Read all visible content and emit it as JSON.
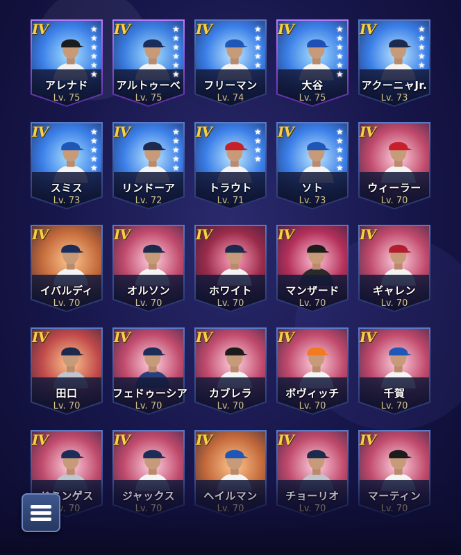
{
  "cards": [
    {
      "grade": "IV",
      "name": "アレナド",
      "level": "Lv. 75",
      "photo_bg": "#3b7fe8",
      "photo_fx": "#a7e0ff",
      "cap": "#1c1c1c",
      "jersey": "#f2f2f2",
      "stars": 6,
      "frame": "purple"
    },
    {
      "grade": "IV",
      "name": "アルトゥーベ",
      "level": "Lv. 75",
      "photo_bg": "#3a7ce0",
      "photo_fx": "#a7e0ff",
      "cap": "#1d2d5a",
      "jersey": "#f2f2f2",
      "stars": 6,
      "frame": "purple"
    },
    {
      "grade": "IV",
      "name": "フリーマン",
      "level": "Lv. 74",
      "photo_bg": "#3b7fe8",
      "photo_fx": "#bfe8ff",
      "cap": "#1e57b7",
      "jersey": "#f4f4f4",
      "stars": 5,
      "frame": "blue"
    },
    {
      "grade": "IV",
      "name": "大谷",
      "level": "Lv. 75",
      "photo_bg": "#3c7fe6",
      "photo_fx": "#a7e0ff",
      "cap": "#1f4fb5",
      "jersey": "#f4f4f4",
      "stars": 6,
      "frame": "purple"
    },
    {
      "grade": "IV",
      "name": "アクーニャJr.",
      "level": "Lv. 73",
      "photo_bg": "#3b7fe8",
      "photo_fx": "#bfe8ff",
      "cap": "#1c2a4d",
      "jersey": "#f4f4f4",
      "stars": 5,
      "frame": "blue"
    },
    {
      "grade": "IV",
      "name": "スミス",
      "level": "Lv. 73",
      "photo_bg": "#3b7fe8",
      "photo_fx": "#a7e0ff",
      "cap": "#1e57b7",
      "jersey": "#f4f4f4",
      "stars": 5,
      "frame": "blue"
    },
    {
      "grade": "IV",
      "name": "リンドーア",
      "level": "Lv. 72",
      "photo_bg": "#3b7fe8",
      "photo_fx": "#bfe8ff",
      "cap": "#1c2a4d",
      "jersey": "#f4f4f4",
      "stars": 5,
      "frame": "blue"
    },
    {
      "grade": "IV",
      "name": "トラウト",
      "level": "Lv. 71",
      "photo_bg": "#3b7fe8",
      "photo_fx": "#bfe8ff",
      "cap": "#c8202b",
      "jersey": "#f4f4f4",
      "stars": 4,
      "frame": "blue"
    },
    {
      "grade": "IV",
      "name": "ソト",
      "level": "Lv. 73",
      "photo_bg": "#3b7fe8",
      "photo_fx": "#bfe8ff",
      "cap": "#1e57b7",
      "jersey": "#f4f4f4",
      "stars": 5,
      "frame": "blue"
    },
    {
      "grade": "IV",
      "name": "ウィーラー",
      "level": "Lv. 70",
      "photo_bg": "#c04a6c",
      "photo_fx": "#ffd1e0",
      "cap": "#c8202b",
      "jersey": "#f4f4f4",
      "stars": 0,
      "frame": "blue"
    },
    {
      "grade": "IV",
      "name": "イバルディ",
      "level": "Lv. 70",
      "photo_bg": "#c46a3b",
      "photo_fx": "#ffc68e",
      "cap": "#1d2d5a",
      "jersey": "#f4f4f4",
      "stars": 0,
      "frame": "blue"
    },
    {
      "grade": "IV",
      "name": "オルソン",
      "level": "Lv. 70",
      "photo_bg": "#c04a6c",
      "photo_fx": "#ffd1e0",
      "cap": "#1c2a4d",
      "jersey": "#f4f4f4",
      "stars": 0,
      "frame": "blue"
    },
    {
      "grade": "IV",
      "name": "ホワイト",
      "level": "Lv. 70",
      "photo_bg": "#9a2b4a",
      "photo_fx": "#ff9fbd",
      "cap": "#1c2a4d",
      "jersey": "#f4f4f4",
      "stars": 0,
      "frame": "blue"
    },
    {
      "grade": "IV",
      "name": "マンザード",
      "level": "Lv. 70",
      "photo_bg": "#b3305a",
      "photo_fx": "#ffc0d6",
      "cap": "#1c1c1c",
      "jersey": "#2a2a2a",
      "stars": 0,
      "frame": "blue"
    },
    {
      "grade": "IV",
      "name": "ギャレン",
      "level": "Lv. 70",
      "photo_bg": "#c04a6c",
      "photo_fx": "#ffd1e0",
      "cap": "#b11e2e",
      "jersey": "#f4f4f4",
      "stars": 0,
      "frame": "blue"
    },
    {
      "grade": "IV",
      "name": "田口",
      "level": "Lv. 70",
      "photo_bg": "#c04a4a",
      "photo_fx": "#ffc68e",
      "cap": "#1c2a4d",
      "jersey": "#c0c4cc",
      "stars": 0,
      "frame": "blue"
    },
    {
      "grade": "IV",
      "name": "フェドゥーシア",
      "level": "Lv. 70",
      "photo_bg": "#c04a6c",
      "photo_fx": "#ffd1e0",
      "cap": "#1d2d5a",
      "jersey": "#2a3f7a",
      "stars": 0,
      "frame": "blue"
    },
    {
      "grade": "IV",
      "name": "カブレラ",
      "level": "Lv. 70",
      "photo_bg": "#c04a6c",
      "photo_fx": "#ffd1e0",
      "cap": "#1c1c1c",
      "jersey": "#f4f4f4",
      "stars": 0,
      "frame": "blue"
    },
    {
      "grade": "IV",
      "name": "ボヴィッチ",
      "level": "Lv. 70",
      "photo_bg": "#c04a6c",
      "photo_fx": "#ffd1e0",
      "cap": "#f47a1f",
      "jersey": "#f4f4f4",
      "stars": 0,
      "frame": "blue"
    },
    {
      "grade": "IV",
      "name": "千賀",
      "level": "Lv. 70",
      "photo_bg": "#c04a6c",
      "photo_fx": "#ffd1e0",
      "cap": "#1e57b7",
      "jersey": "#f4f4f4",
      "stars": 0,
      "frame": "blue"
    },
    {
      "grade": "IV",
      "name": "ドミンゲス",
      "level": "Lv. 70",
      "photo_bg": "#c04a6c",
      "photo_fx": "#ffd1e0",
      "cap": "#1d2d5a",
      "jersey": "#c0c4cc",
      "stars": 0,
      "frame": "blue"
    },
    {
      "grade": "IV",
      "name": "ジャックス",
      "level": "Lv. 70",
      "photo_bg": "#c04a6c",
      "photo_fx": "#ffd1e0",
      "cap": "#1d2d5a",
      "jersey": "#f4f4f4",
      "stars": 0,
      "frame": "blue"
    },
    {
      "grade": "IV",
      "name": "ヘイルマン",
      "level": "Lv. 70",
      "photo_bg": "#c46a3b",
      "photo_fx": "#ffc68e",
      "cap": "#1e57b7",
      "jersey": "#f4f4f4",
      "stars": 0,
      "frame": "blue"
    },
    {
      "grade": "IV",
      "name": "チョーリオ",
      "level": "Lv. 70",
      "photo_bg": "#c04a6c",
      "photo_fx": "#ffd1e0",
      "cap": "#1c2a4d",
      "jersey": "#c0c4cc",
      "stars": 0,
      "frame": "blue"
    },
    {
      "grade": "IV",
      "name": "マーティン",
      "level": "Lv. 70",
      "photo_bg": "#c04a6c",
      "photo_fx": "#ffd1e0",
      "cap": "#1c1c1c",
      "jersey": "#f4f4f4",
      "stars": 0,
      "frame": "blue"
    }
  ],
  "menu": {
    "icon": "hamburger-menu-icon"
  },
  "colors": {
    "grade": "#f6d04a",
    "level": "#d4c28a",
    "background": "#17164a",
    "menu_button": "#3f5890"
  }
}
